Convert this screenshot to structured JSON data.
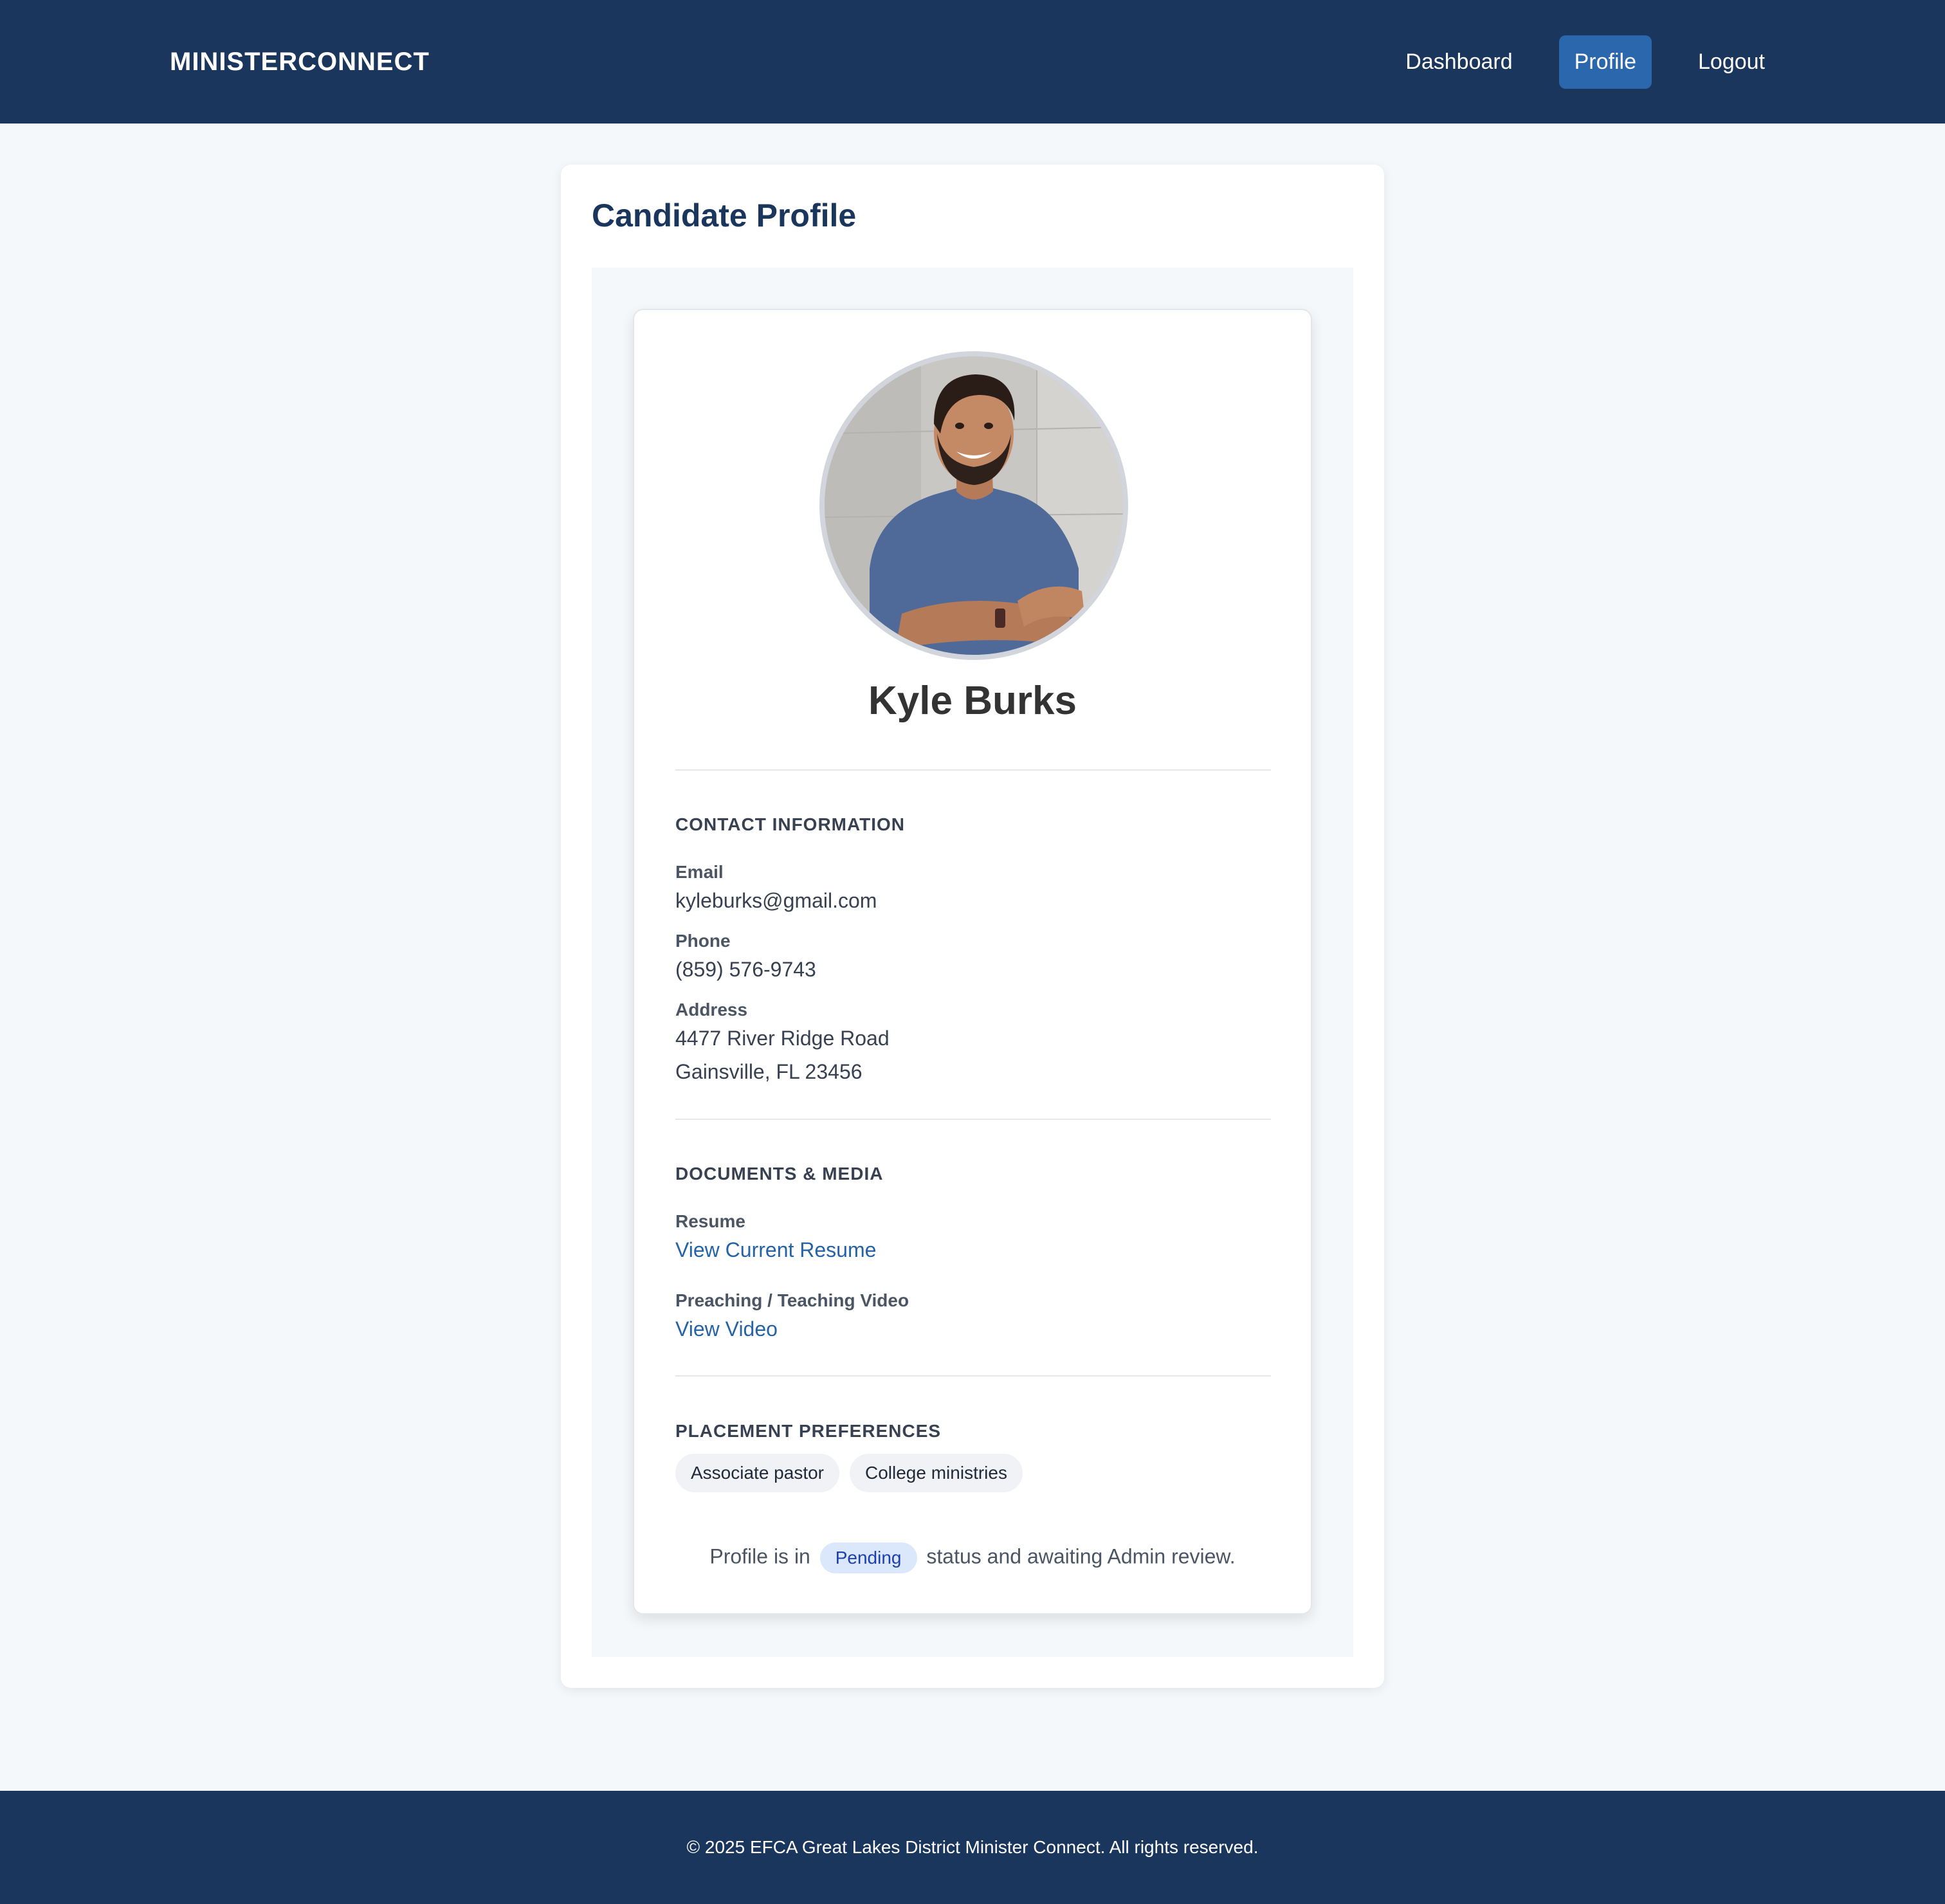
{
  "header": {
    "brand": "MINISTERCONNECT",
    "nav": [
      {
        "label": "Dashboard",
        "active": false
      },
      {
        "label": "Profile",
        "active": true
      },
      {
        "label": "Logout",
        "active": false
      }
    ]
  },
  "page": {
    "title": "Candidate Profile"
  },
  "profile": {
    "name": "Kyle Burks",
    "contact": {
      "section_title": "CONTACT INFORMATION",
      "email_label": "Email",
      "email": "kyleburks@gmail.com",
      "phone_label": "Phone",
      "phone": "(859) 576-9743",
      "address_label": "Address",
      "address_line1": "4477 River Ridge Road",
      "address_line2": "Gainsville, FL 23456"
    },
    "documents": {
      "section_title": "DOCUMENTS & MEDIA",
      "resume_label": "Resume",
      "resume_link": "View Current Resume",
      "video_label": "Preaching / Teaching Video",
      "video_link": "View Video"
    },
    "preferences": {
      "section_title": "PLACEMENT PREFERENCES",
      "items": [
        "Associate pastor",
        "College ministries"
      ]
    },
    "status": {
      "prefix": "Profile is in",
      "badge": "Pending",
      "suffix": "status and awaiting Admin review."
    }
  },
  "footer": {
    "text": "© 2025 EFCA Great Lakes District Minister Connect. All rights reserved."
  },
  "colors": {
    "nav_bg": "#1b365d",
    "nav_active": "#2b67ad",
    "link": "#2563a8",
    "badge_bg": "#dbe8fb"
  }
}
